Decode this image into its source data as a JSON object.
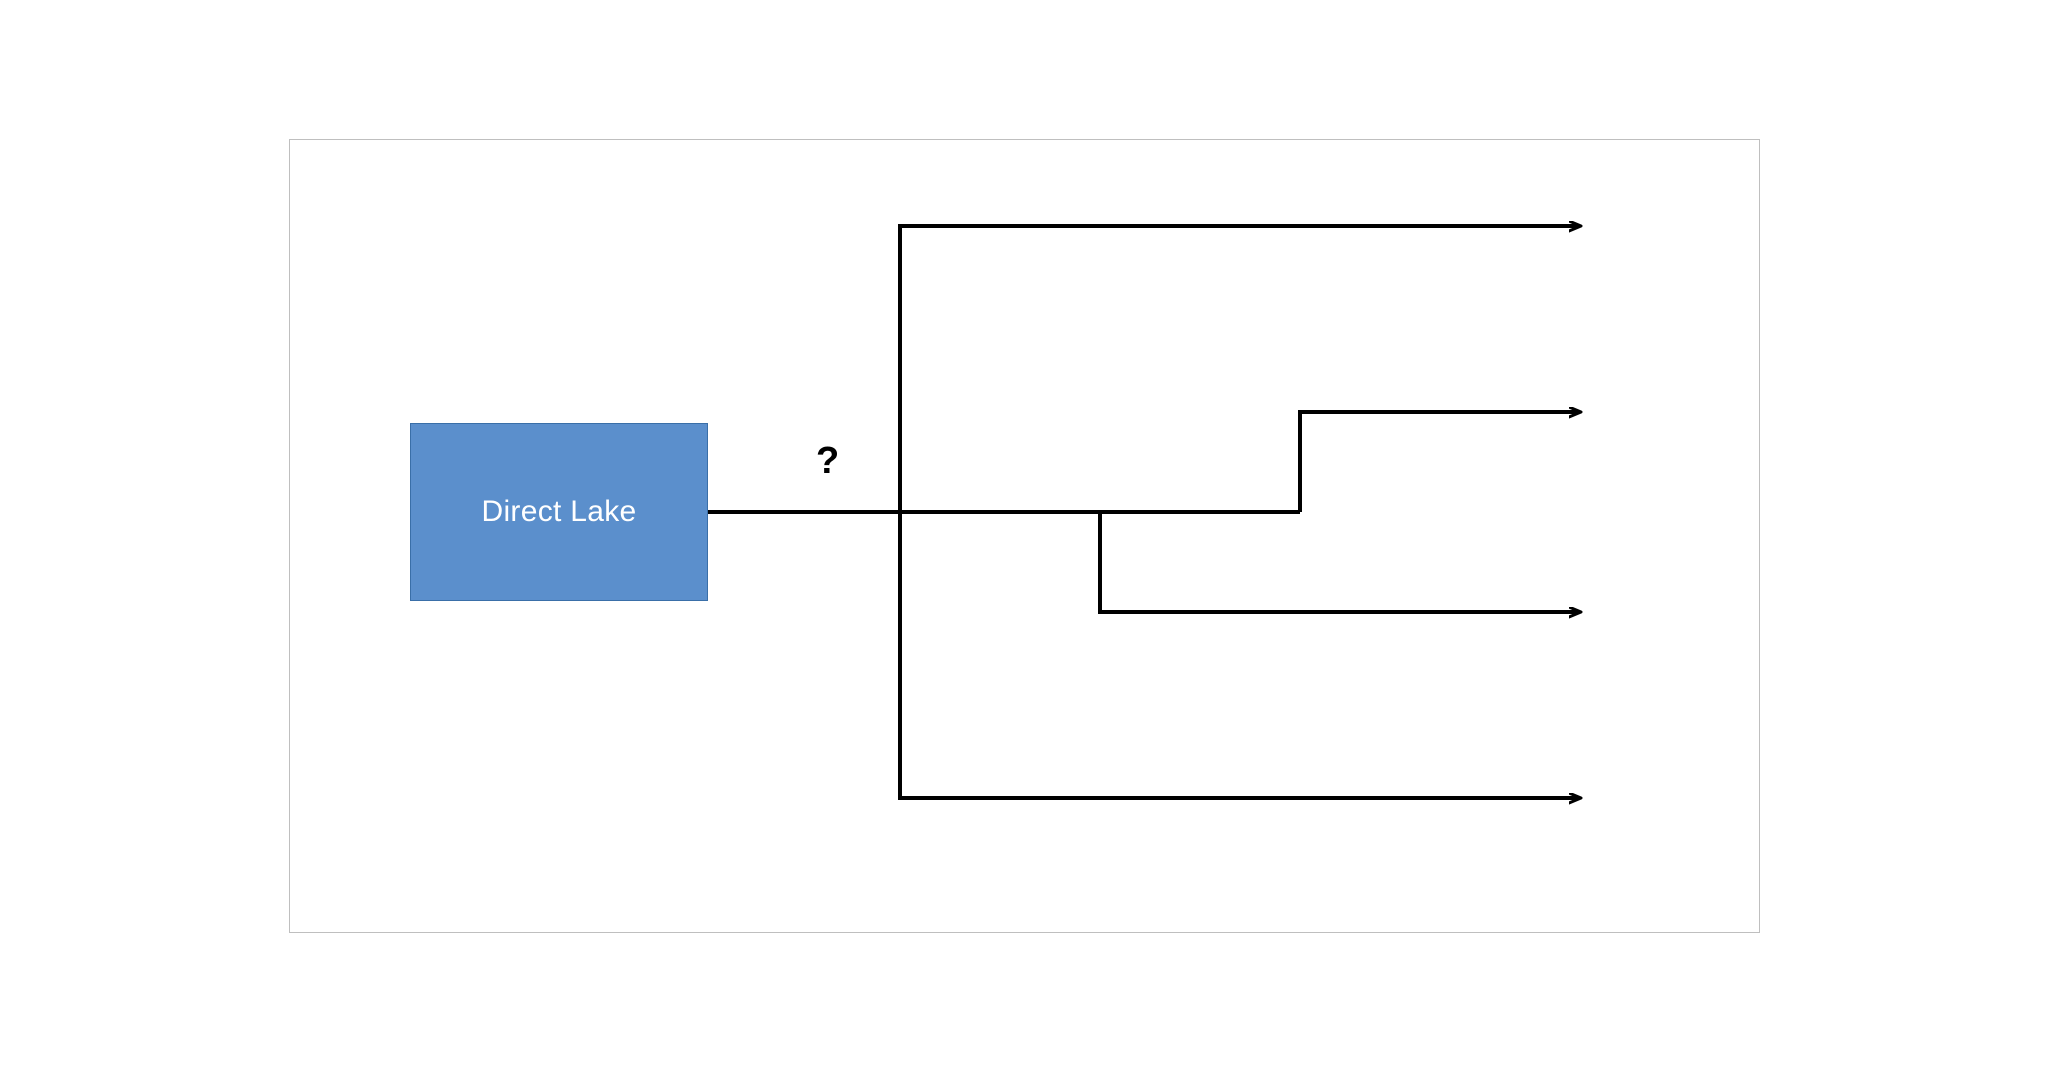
{
  "node": {
    "label": "Direct Lake"
  },
  "question": "?",
  "colors": {
    "node_fill": "#5b8fcc",
    "node_stroke": "#3a6fa8",
    "connector": "#000000",
    "border": "#bfbfbf"
  }
}
